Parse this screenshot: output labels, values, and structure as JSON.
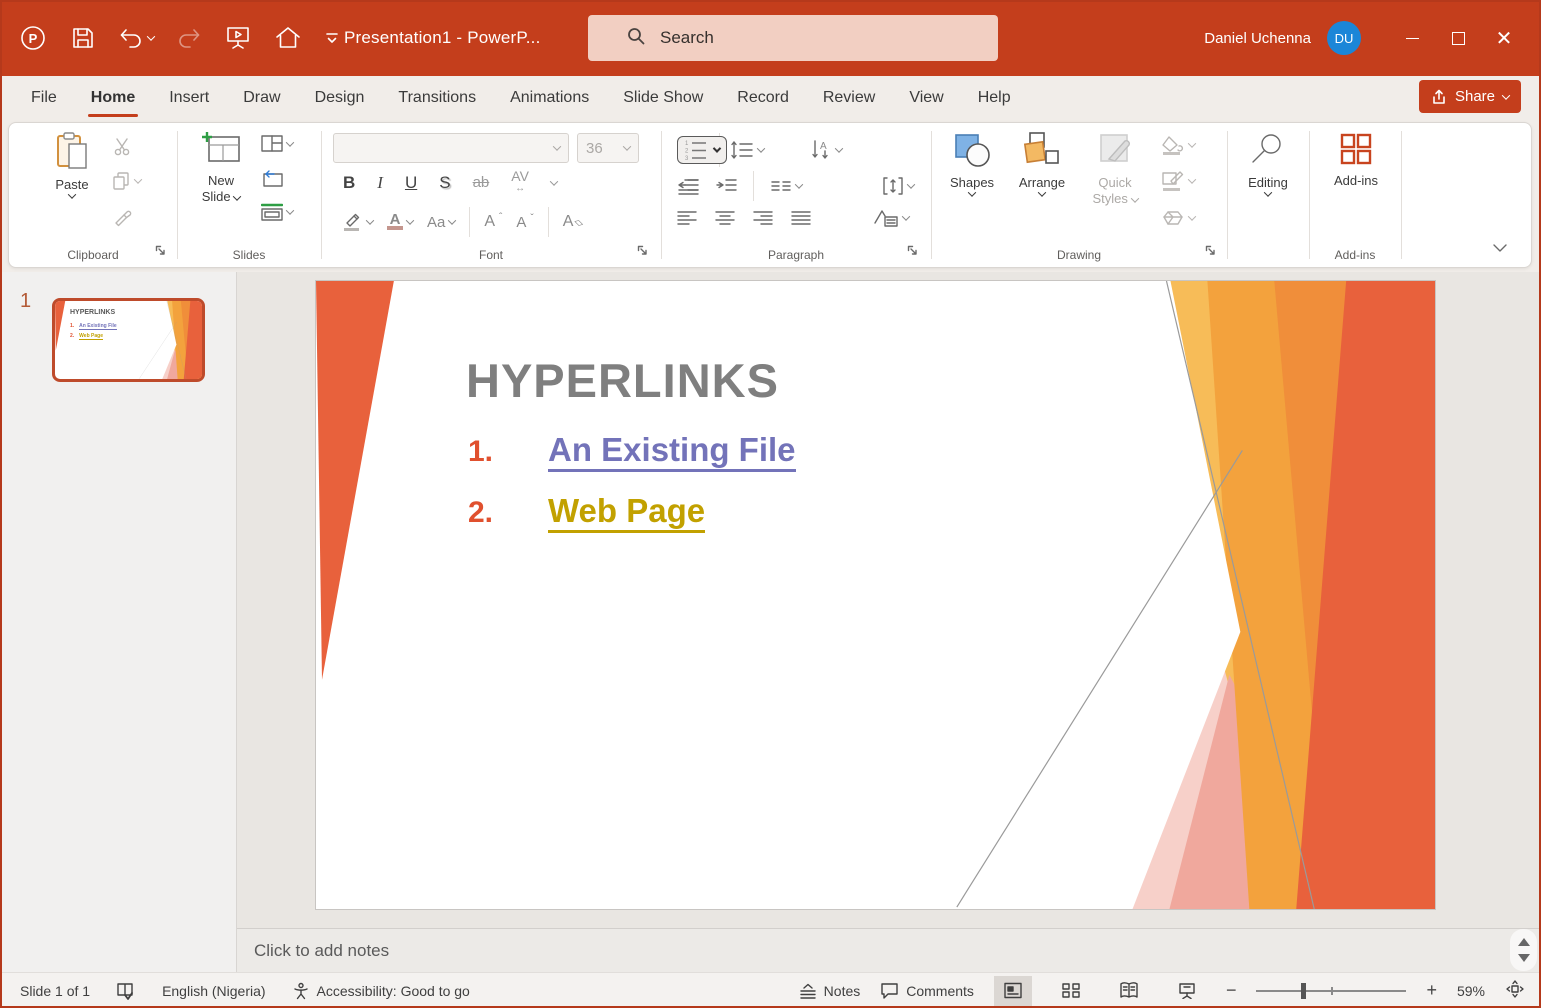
{
  "titlebar": {
    "title": "Presentation1 - PowerP...",
    "search_placeholder": "Search",
    "user_name": "Daniel Uchenna",
    "user_initials": "DU"
  },
  "tabs": {
    "items": [
      {
        "label": "File"
      },
      {
        "label": "Home"
      },
      {
        "label": "Insert"
      },
      {
        "label": "Draw"
      },
      {
        "label": "Design"
      },
      {
        "label": "Transitions"
      },
      {
        "label": "Animations"
      },
      {
        "label": "Slide Show"
      },
      {
        "label": "Record"
      },
      {
        "label": "Review"
      },
      {
        "label": "View"
      },
      {
        "label": "Help"
      }
    ],
    "active": "Home",
    "share": "Share"
  },
  "ribbon": {
    "clipboard": {
      "paste": "Paste",
      "label": "Clipboard"
    },
    "slides": {
      "new_line1": "New",
      "new_line2": "Slide",
      "label": "Slides"
    },
    "font": {
      "size": "36",
      "bold": "B",
      "italic": "I",
      "underline": "U",
      "shadow": "S",
      "strike": "ab",
      "spacing": "AV",
      "case": "Aa",
      "grow": "A",
      "shrink": "A",
      "clear": "A",
      "label": "Font"
    },
    "paragraph": {
      "label": "Paragraph"
    },
    "drawing": {
      "shapes": "Shapes",
      "arrange": "Arrange",
      "quick1": "Quick",
      "quick2": "Styles",
      "label": "Drawing"
    },
    "editing": {
      "label": "Editing"
    },
    "addins": {
      "button": "Add-ins",
      "label": "Add-ins"
    }
  },
  "slide_panel": {
    "number": "1"
  },
  "slide": {
    "title": "HYPERLINKS",
    "items": [
      {
        "num": "1.",
        "text": "An Existing File"
      },
      {
        "num": "2.",
        "text": "Web Page"
      }
    ]
  },
  "notes": {
    "placeholder": "Click to add notes"
  },
  "status": {
    "slide_info": "Slide 1 of 1",
    "language": "English (Nigeria)",
    "accessibility": "Accessibility: Good to go",
    "notes_label": "Notes",
    "comments_label": "Comments",
    "zoom_level": "59%"
  },
  "colors": {
    "titlebar_red": "#C43E1C",
    "avatar_blue": "#1B86D8",
    "slide_title_gray": "#7F7F7F",
    "list_number_red": "#E0502E",
    "link_existing_file": "#7373B9",
    "link_web_page": "#C2A100",
    "theme_deep_orange": "#E8613C",
    "theme_gold": "#F3A23D"
  }
}
